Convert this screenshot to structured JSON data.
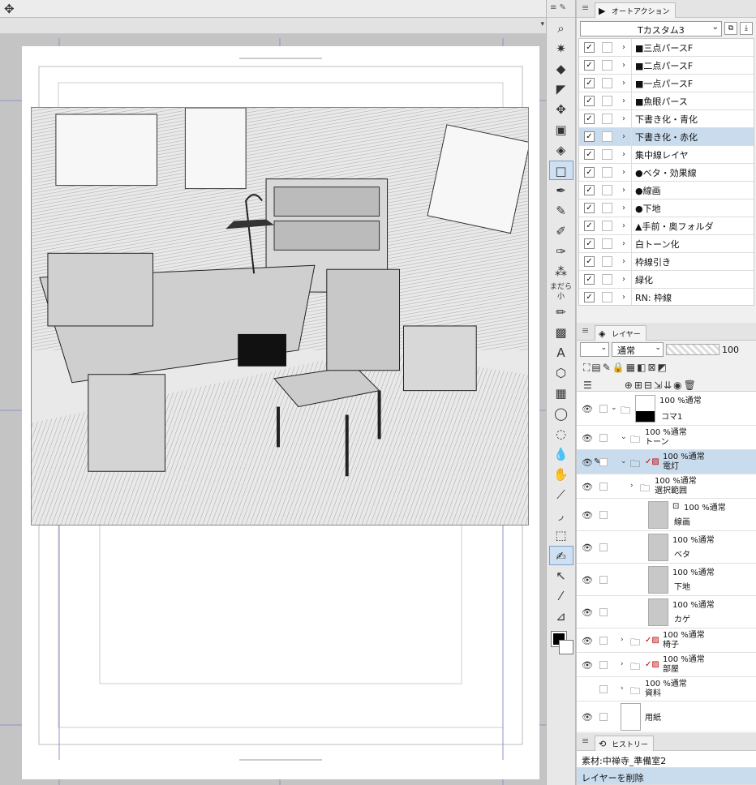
{
  "auto_action": {
    "tab_label": "オートアクション",
    "set_name": "Tカスタム3",
    "items": [
      {
        "label": "■三点パースF",
        "enabled": true,
        "selected": false
      },
      {
        "label": "■二点パースF",
        "enabled": true,
        "selected": false
      },
      {
        "label": "■一点パースF",
        "enabled": true,
        "selected": false
      },
      {
        "label": "■魚眼パース",
        "enabled": true,
        "selected": false
      },
      {
        "label": "下書き化・青化",
        "enabled": true,
        "selected": false
      },
      {
        "label": "下書き化・赤化",
        "enabled": true,
        "selected": true
      },
      {
        "label": "集中線レイヤ",
        "enabled": true,
        "selected": false
      },
      {
        "label": "●ベタ・効果線",
        "enabled": true,
        "selected": false
      },
      {
        "label": "●線画",
        "enabled": true,
        "selected": false
      },
      {
        "label": "●下地",
        "enabled": true,
        "selected": false
      },
      {
        "label": "▲手前・奥フォルダ",
        "enabled": true,
        "selected": false
      },
      {
        "label": "白トーン化",
        "enabled": true,
        "selected": false
      },
      {
        "label": "枠線引き",
        "enabled": true,
        "selected": false
      },
      {
        "label": "緑化",
        "enabled": true,
        "selected": false
      },
      {
        "label": "RN: 枠線",
        "enabled": true,
        "selected": false
      }
    ]
  },
  "layer_panel": {
    "tab_label": "レイヤー",
    "blend_mode": "通常",
    "opacity": "100",
    "layers": [
      {
        "prop": "100 %通常",
        "name": "コマ1",
        "type": "folder"
      },
      {
        "prop": "100 %通常",
        "name": "トーン",
        "type": "folder"
      },
      {
        "prop": "100 %通常",
        "name": "電灯",
        "type": "folder"
      },
      {
        "prop": "100 %通常",
        "name": "選択範囲",
        "type": "folder"
      },
      {
        "prop": "100 %通常",
        "name": "線画",
        "type": "layer"
      },
      {
        "prop": "100 %通常",
        "name": "ベタ",
        "type": "layer"
      },
      {
        "prop": "100 %通常",
        "name": "下地",
        "type": "layer"
      },
      {
        "prop": "100 %通常",
        "name": "カゲ",
        "type": "layer"
      },
      {
        "prop": "100 %通常",
        "name": "椅子",
        "type": "folder"
      },
      {
        "prop": "100 %通常",
        "name": "部屋",
        "type": "folder"
      },
      {
        "prop": "100 %通常",
        "name": "資料",
        "type": "folder"
      },
      {
        "prop": "",
        "name": "用紙",
        "type": "paper"
      }
    ]
  },
  "history": {
    "tab_label": "ヒストリー",
    "items": [
      {
        "label": "素材:中禅寺_準備室2",
        "selected": false
      },
      {
        "label": "レイヤーを削除",
        "selected": true
      }
    ]
  },
  "colors": {
    "accent": "#c9dcee",
    "main": "#000000",
    "sub": "#ffffff"
  }
}
